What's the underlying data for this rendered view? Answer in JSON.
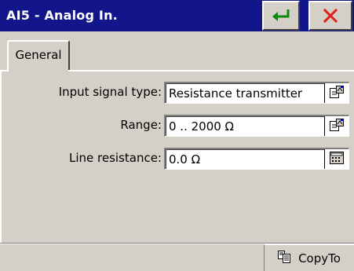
{
  "window": {
    "title": "AI5 - Analog In.",
    "ok_icon": "enter-arrow-icon",
    "close_icon": "close-x-icon"
  },
  "tabs": [
    {
      "label": "General",
      "selected": true
    }
  ],
  "fields": [
    {
      "label": "Input signal type:",
      "value": "Resistance transmitter",
      "button_icon": "properties-icon"
    },
    {
      "label": "Range:",
      "value": "0 .. 2000 Ω",
      "button_icon": "properties-icon"
    },
    {
      "label": "Line resistance:",
      "value": "0.0 Ω",
      "button_icon": "keypad-icon"
    }
  ],
  "footer": {
    "copyto_label": "CopyTo",
    "copyto_icon": "copy-icon"
  },
  "colors": {
    "titlebar": "#13168a",
    "face": "#d4d0c8",
    "ok_arrow": "#0a8a0a",
    "close_x": "#e0201a"
  }
}
